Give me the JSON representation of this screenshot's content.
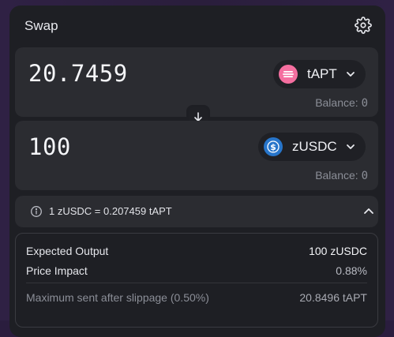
{
  "header": {
    "title": "Swap",
    "settings_icon": "gear-icon"
  },
  "from": {
    "amount": "20.7459",
    "token": "tAPT",
    "token_icon": "tapt-token-icon",
    "token_color": "#f56fa0",
    "balance_label": "Balance:",
    "balance_value": "0"
  },
  "switch": {
    "icon": "arrow-down-icon"
  },
  "to": {
    "amount": "100",
    "token": "zUSDC",
    "token_icon": "usdc-token-icon",
    "token_color": "#2775ca",
    "balance_label": "Balance:",
    "balance_value": "0"
  },
  "rate": {
    "text": "1 zUSDC = 0.207459 tAPT",
    "info_icon": "info-icon",
    "toggle_icon": "chevron-up-icon"
  },
  "details": {
    "expected_output_label": "Expected Output",
    "expected_output_value": "100 zUSDC",
    "price_impact_label": "Price Impact",
    "price_impact_value": "0.88%",
    "max_sent_label": "Maximum sent after slippage (0.50%)",
    "max_sent_value": "20.8496 tAPT"
  }
}
